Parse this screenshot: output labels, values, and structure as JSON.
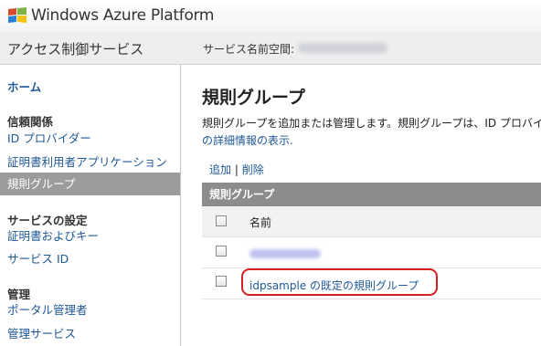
{
  "topbar": {
    "brand": "Windows Azure Platform"
  },
  "header": {
    "service_title": "アクセス制御サービス",
    "namespace_label": "サービス名前空間:"
  },
  "sidebar": {
    "home": "ホーム",
    "groups": [
      {
        "title": "信頼関係",
        "items": [
          "ID プロバイダー",
          "証明書利用者アプリケーション",
          "規則グループ"
        ]
      },
      {
        "title": "サービスの設定",
        "items": [
          "証明書およびキー",
          "サービス ID"
        ]
      },
      {
        "title": "管理",
        "items": [
          "ポータル管理者",
          "管理サービス"
        ]
      }
    ],
    "active_item": "規則グループ"
  },
  "main": {
    "title": "規則グループ",
    "description_line1": "規則グループを追加または管理します。規則グループは、ID プロバイダー",
    "description_line2": "の詳細情報の表示.",
    "actions": {
      "add": "追加",
      "separator": "|",
      "delete": "削除"
    },
    "grid": {
      "heading": "規則グループ",
      "column_name": "名前",
      "rows": [
        "idpsample の既定の規則グループ"
      ]
    }
  },
  "colors": {
    "link": "#1e5896",
    "active_nav": "#9c9c9c",
    "grid_header": "#8c8c8c",
    "highlight": "#d42020"
  }
}
